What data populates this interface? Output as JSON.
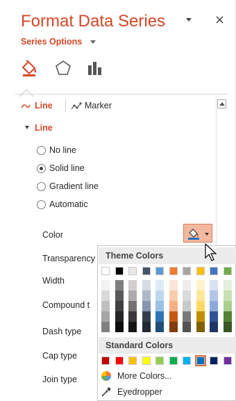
{
  "pane": {
    "title": "Format Data Series",
    "close": "×",
    "series_options": "Series Options"
  },
  "category_icons": [
    "fill-line-icon",
    "effects-icon",
    "series-options-icon"
  ],
  "subtabs": {
    "line": "Line",
    "marker": "Marker"
  },
  "section": {
    "title": "Line"
  },
  "line_options": [
    {
      "label": "No line",
      "checked": false
    },
    {
      "label": "Solid line",
      "checked": true
    },
    {
      "label": "Gradient line",
      "checked": false
    },
    {
      "label": "Automatic",
      "checked": false
    }
  ],
  "properties": {
    "color": "Color",
    "transparency": "Transparency",
    "width": "Width",
    "compound": "Compound t",
    "dash": "Dash type",
    "cap": "Cap type",
    "join": "Join type"
  },
  "color_picker": {
    "theme_header": "Theme Colors",
    "standard_header": "Standard Colors",
    "more_colors": "More Colors...",
    "eyedropper": "Eyedropper",
    "theme_colors": [
      "#ffffff",
      "#000000",
      "#e7e6e6",
      "#44546a",
      "#5b9bd5",
      "#ed7d31",
      "#a5a5a5",
      "#ffc000",
      "#4472c4",
      "#70ad47"
    ],
    "theme_shades": [
      [
        "#f2f2f2",
        "#d9d9d9",
        "#bfbfbf",
        "#a6a6a6",
        "#808080"
      ],
      [
        "#808080",
        "#595959",
        "#404040",
        "#262626",
        "#0d0d0d"
      ],
      [
        "#d0cece",
        "#aeabab",
        "#757171",
        "#3a3838",
        "#171616"
      ],
      [
        "#d6dce4",
        "#adb9ca",
        "#8496b0",
        "#333f4f",
        "#222a35"
      ],
      [
        "#ddebf7",
        "#bdd7ee",
        "#9bc2e6",
        "#2f75b5",
        "#1f4e78"
      ],
      [
        "#fce4d6",
        "#f8cbad",
        "#f4b084",
        "#c65911",
        "#833c0c"
      ],
      [
        "#ededed",
        "#dbdbdb",
        "#c9c9c9",
        "#7b7b7b",
        "#525252"
      ],
      [
        "#fff2cc",
        "#ffe699",
        "#ffd966",
        "#bf8f00",
        "#806000"
      ],
      [
        "#d9e1f2",
        "#b4c6e7",
        "#8ea9db",
        "#305496",
        "#203764"
      ],
      [
        "#e2efda",
        "#c6e0b4",
        "#a9d08e",
        "#548235",
        "#375623"
      ]
    ],
    "standard_colors": [
      "#c00000",
      "#ff0000",
      "#ffc000",
      "#ffff00",
      "#92d050",
      "#00b050",
      "#00b0f0",
      "#0070c0",
      "#002060",
      "#7030a0"
    ],
    "selected_standard_index": 7
  }
}
